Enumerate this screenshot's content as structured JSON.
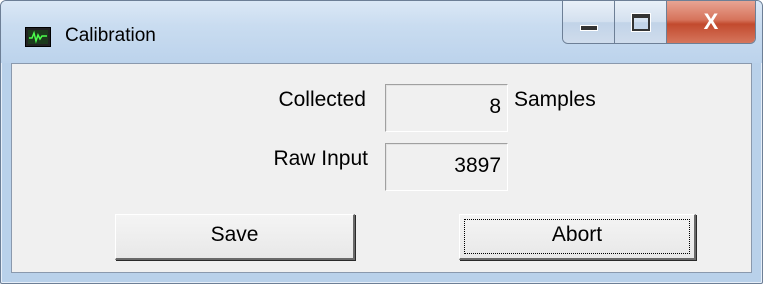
{
  "window": {
    "title": "Calibration",
    "app_icon": "oscilloscope-icon",
    "caption_buttons": {
      "minimize_icon": "minimize-icon",
      "maximize_icon": "maximize-icon",
      "close_glyph": "X"
    }
  },
  "form": {
    "collected": {
      "label": "Collected",
      "value": "8",
      "unit": "Samples"
    },
    "raw_input": {
      "label": "Raw Input",
      "value": "3897"
    }
  },
  "buttons": {
    "save": "Save",
    "abort": "Abort"
  },
  "colors": {
    "frame": "#b9d1ea",
    "client": "#f0f0f0",
    "close_button": "#c24a2e"
  }
}
